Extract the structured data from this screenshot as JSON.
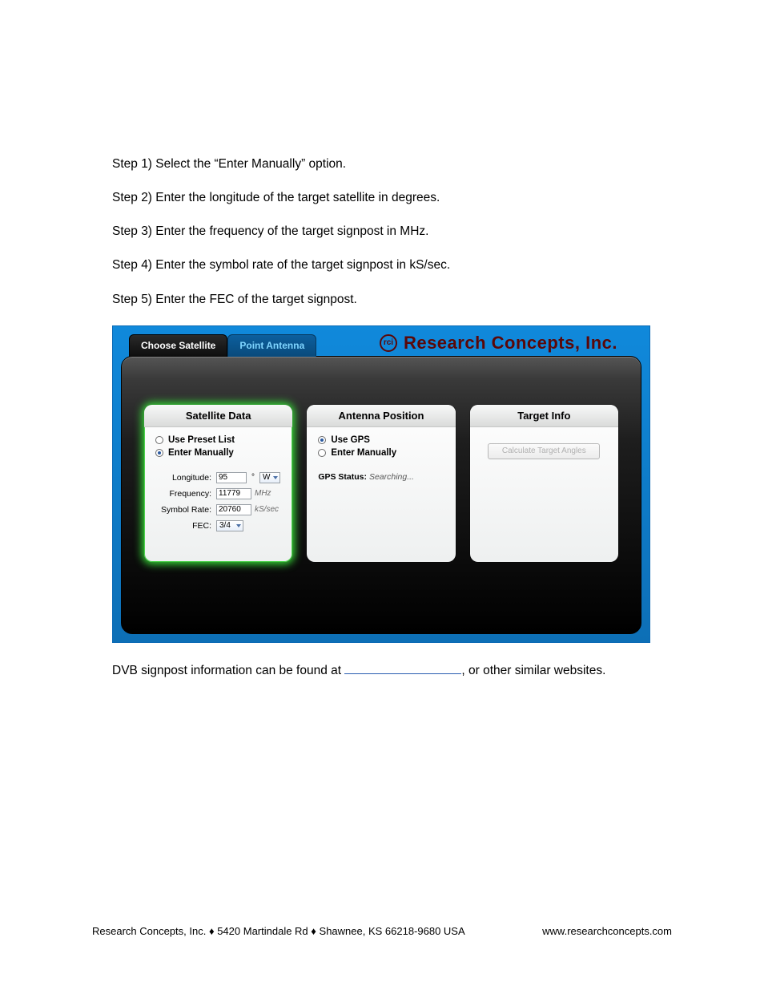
{
  "steps": [
    "Step 1) Select the “Enter Manually” option.",
    "Step 2) Enter the longitude of the target satellite in degrees.",
    "Step 3) Enter the frequency of the target signpost in MHz.",
    "Step 4) Enter the symbol rate of the target signpost in kS/sec.",
    "Step 5) Enter the FEC of the target signpost."
  ],
  "tabs": {
    "choose": "Choose Satellite",
    "point": "Point Antenna"
  },
  "brand": "Research Concepts, Inc.",
  "brand_mark": "rci",
  "panels": {
    "satellite": {
      "title": "Satellite Data",
      "opt_preset": "Use Preset List",
      "opt_manual": "Enter Manually",
      "longitude_label": "Longitude:",
      "longitude_value": "95",
      "longitude_deg": "°",
      "longitude_hemi": "W",
      "frequency_label": "Frequency:",
      "frequency_value": "11779",
      "frequency_unit": "MHz",
      "symbolrate_label": "Symbol Rate:",
      "symbolrate_value": "20760",
      "symbolrate_unit": "kS/sec",
      "fec_label": "FEC:",
      "fec_value": "3/4"
    },
    "antenna": {
      "title": "Antenna Position",
      "opt_gps": "Use GPS",
      "opt_manual": "Enter Manually",
      "gps_label": "GPS Status:",
      "gps_value": "Searching..."
    },
    "target": {
      "title": "Target Info",
      "calc_btn": "Calculate Target Angles"
    }
  },
  "caption_pre": "DVB signpost information can be found at ",
  "caption_post": ", or other similar websites.",
  "footer": {
    "left": "Research Concepts, Inc. ♦ 5420 Martindale Rd ♦ Shawnee, KS 66218-9680 USA",
    "right": "www.researchconcepts.com"
  }
}
